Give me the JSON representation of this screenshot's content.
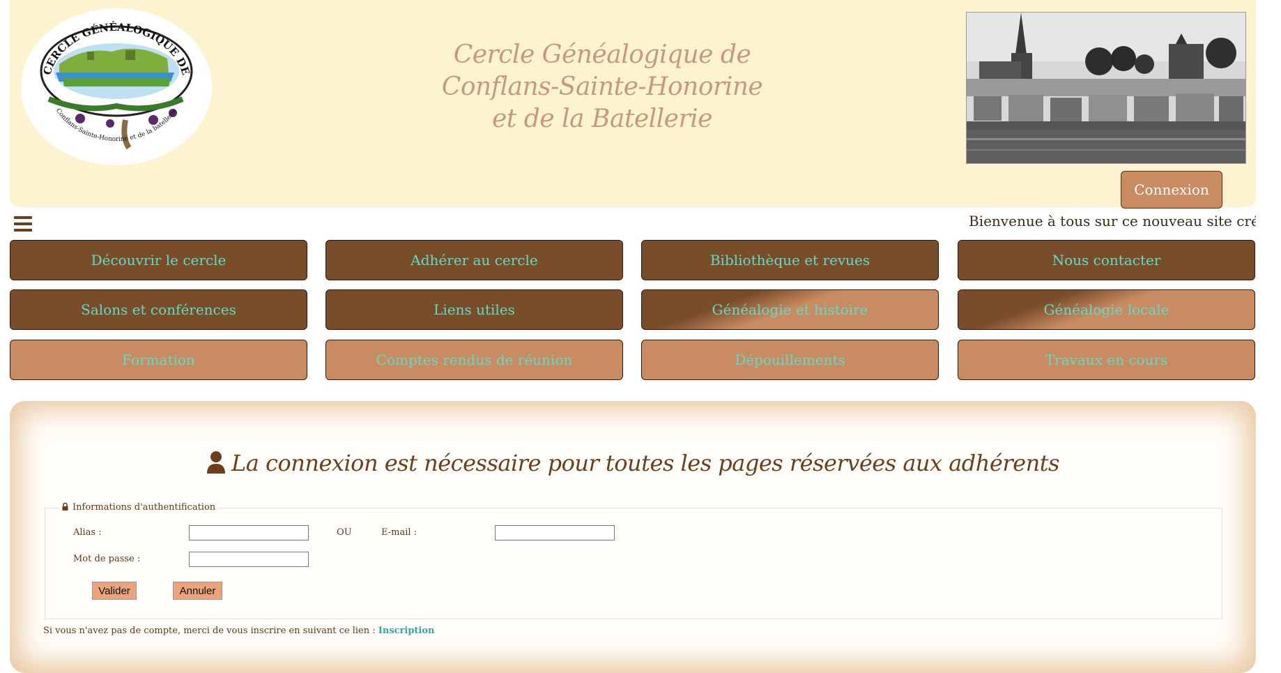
{
  "header": {
    "logo_arc_text": "CERCLE GÉNÉALOGIQUE DE",
    "logo_bottom_text": "Conflans-Sainte-Honorine et de la batellerie",
    "title_lines": [
      "Cercle Généalogique de",
      "Conflans-Sainte-Honorine",
      "et de la Batellerie"
    ],
    "login_label": "Connexion"
  },
  "ticker": {
    "text": "Bienvenue à tous sur ce nouveau site créé spéc"
  },
  "nav": [
    {
      "label": "Découvrir le cercle",
      "style": "dark"
    },
    {
      "label": "Adhérer au cercle",
      "style": "dark"
    },
    {
      "label": "Bibliothèque et revues",
      "style": "dark"
    },
    {
      "label": "Nous contacter",
      "style": "dark"
    },
    {
      "label": "Salons et conférences",
      "style": "dark"
    },
    {
      "label": "Liens utiles",
      "style": "dark"
    },
    {
      "label": "Généalogie et histoire",
      "style": "gradient"
    },
    {
      "label": "Généalogie locale",
      "style": "gradient"
    },
    {
      "label": "Formation",
      "style": "light"
    },
    {
      "label": "Comptes rendus de réunion",
      "style": "light"
    },
    {
      "label": "Dépouillements",
      "style": "light"
    },
    {
      "label": "Travaux en cours",
      "style": "light"
    }
  ],
  "login_panel": {
    "heading": "La connexion est nécessaire pour toutes les pages réservées aux adhérents",
    "legend": "Informations d'authentification",
    "alias_label": "Alias :",
    "or_label": "OU",
    "email_label": "E-mail :",
    "password_label": "Mot de passe :",
    "alias_value": "",
    "email_value": "",
    "password_value": "",
    "submit_label": "Valider",
    "cancel_label": "Annuler",
    "signup_text": "Si vous n'avez pas de compte, merci de vous inscrire en suivant ce lien :",
    "signup_link": "Inscription"
  },
  "colors": {
    "header_bg": "#fdf3d0",
    "nav_dark": "#7a4d2a",
    "nav_light": "#c98b62",
    "nav_text": "#5fdcc8",
    "title_text": "#c69a76",
    "link": "#3aa596"
  }
}
